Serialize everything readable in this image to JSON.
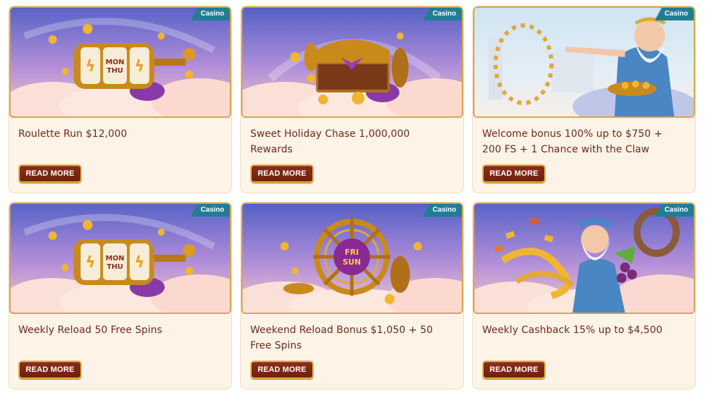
{
  "promotions": [
    {
      "title": "Roulette Run $12,000",
      "badge": "Casino",
      "button": "READ MORE",
      "image": "slot-reels-on-clouds",
      "image_text": "MON THU"
    },
    {
      "title": "Sweet Holiday Chase 1,000,000 Rewards",
      "badge": "Casino",
      "button": "READ MORE",
      "image": "treasure-chest-on-clouds",
      "image_text": ""
    },
    {
      "title": "Welcome bonus 100% up to $750 + 200 FS + 1 Chance with the Claw",
      "badge": "Casino",
      "button": "READ MORE",
      "image": "zeus-with-coin-ring",
      "image_text": ""
    },
    {
      "title": "Weekly Reload 50 Free Spins",
      "badge": "Casino",
      "button": "READ MORE",
      "image": "slot-reels-on-clouds",
      "image_text": "MON THU"
    },
    {
      "title": "Weekend Reload Bonus $1,050 + 50 Free Spins",
      "badge": "Casino",
      "button": "READ MORE",
      "image": "ship-wheel-on-clouds",
      "image_text": "FRI SUN"
    },
    {
      "title": "Weekly Cashback 15% up to $4,500",
      "badge": "Casino",
      "button": "READ MORE",
      "image": "zeus-with-gold-ribbons",
      "image_text": ""
    }
  ],
  "colors": {
    "card_bg": "#fdf3e7",
    "title": "#6b2a16",
    "button_bg": "#7a2712",
    "button_border": "#e7b043",
    "badge_bg": "#1f7e93",
    "gold": "#e0a93a"
  }
}
